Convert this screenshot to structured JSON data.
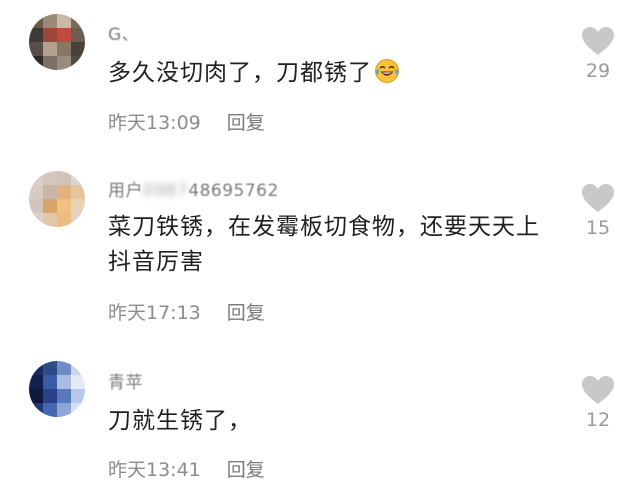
{
  "comments": [
    {
      "username_visible": "G、",
      "text": "多久没切肉了，刀都锈了",
      "emoji": "laughing-crying-emoji",
      "time": "昨天13:09",
      "reply_label": "回复",
      "likes": "29",
      "avatar_colors": [
        "#6b5a4a",
        "#9c8a78",
        "#c9b8a6",
        "#7d6b5c",
        "#3f3a36",
        "#a0453a",
        "#c04a3f",
        "#6e5e52",
        "#5a4f48",
        "#b3a18e",
        "#8a7665",
        "#4a413b",
        "#2e2a27",
        "#7c6f66",
        "#9a8b7f",
        "#54483f"
      ]
    },
    {
      "username_visible": "用户",
      "username_blurred": "0987",
      "username_tail": "48695762",
      "text": "菜刀铁锈，在发霉板切食物，还要天天上抖音厉害",
      "time": "昨天17:13",
      "reply_label": "回复",
      "likes": "15",
      "avatar_colors": [
        "#d9cfc6",
        "#d4c8be",
        "#cfc2b6",
        "#e0d6cd",
        "#d8ccc1",
        "#c8b6a6",
        "#e2b37d",
        "#e6c49b",
        "#d3c5b9",
        "#d9a46a",
        "#f0c080",
        "#e8d2b8",
        "#dcd0c5",
        "#e1c7a7",
        "#ebbd85",
        "#ddd2c8"
      ]
    },
    {
      "username_visible": "青苹",
      "text": "刀就生锈了，",
      "time": "昨天13:41",
      "reply_label": "回复",
      "likes": "12",
      "avatar_colors": [
        "#1b2a5a",
        "#2d4a8a",
        "#6f8bc4",
        "#c9d6ee",
        "#142150",
        "#3b5ba6",
        "#a9bde3",
        "#e3e9f5",
        "#0f1a3e",
        "#27418a",
        "#5a79bd",
        "#b7c7e8",
        "#223870",
        "#4666ae",
        "#8ea6d6",
        "#d6e0f2"
      ]
    }
  ],
  "colors": {
    "heart": "#c8c8c8",
    "meta_text": "#8c8c8c",
    "body_text": "#1f1f1f"
  }
}
